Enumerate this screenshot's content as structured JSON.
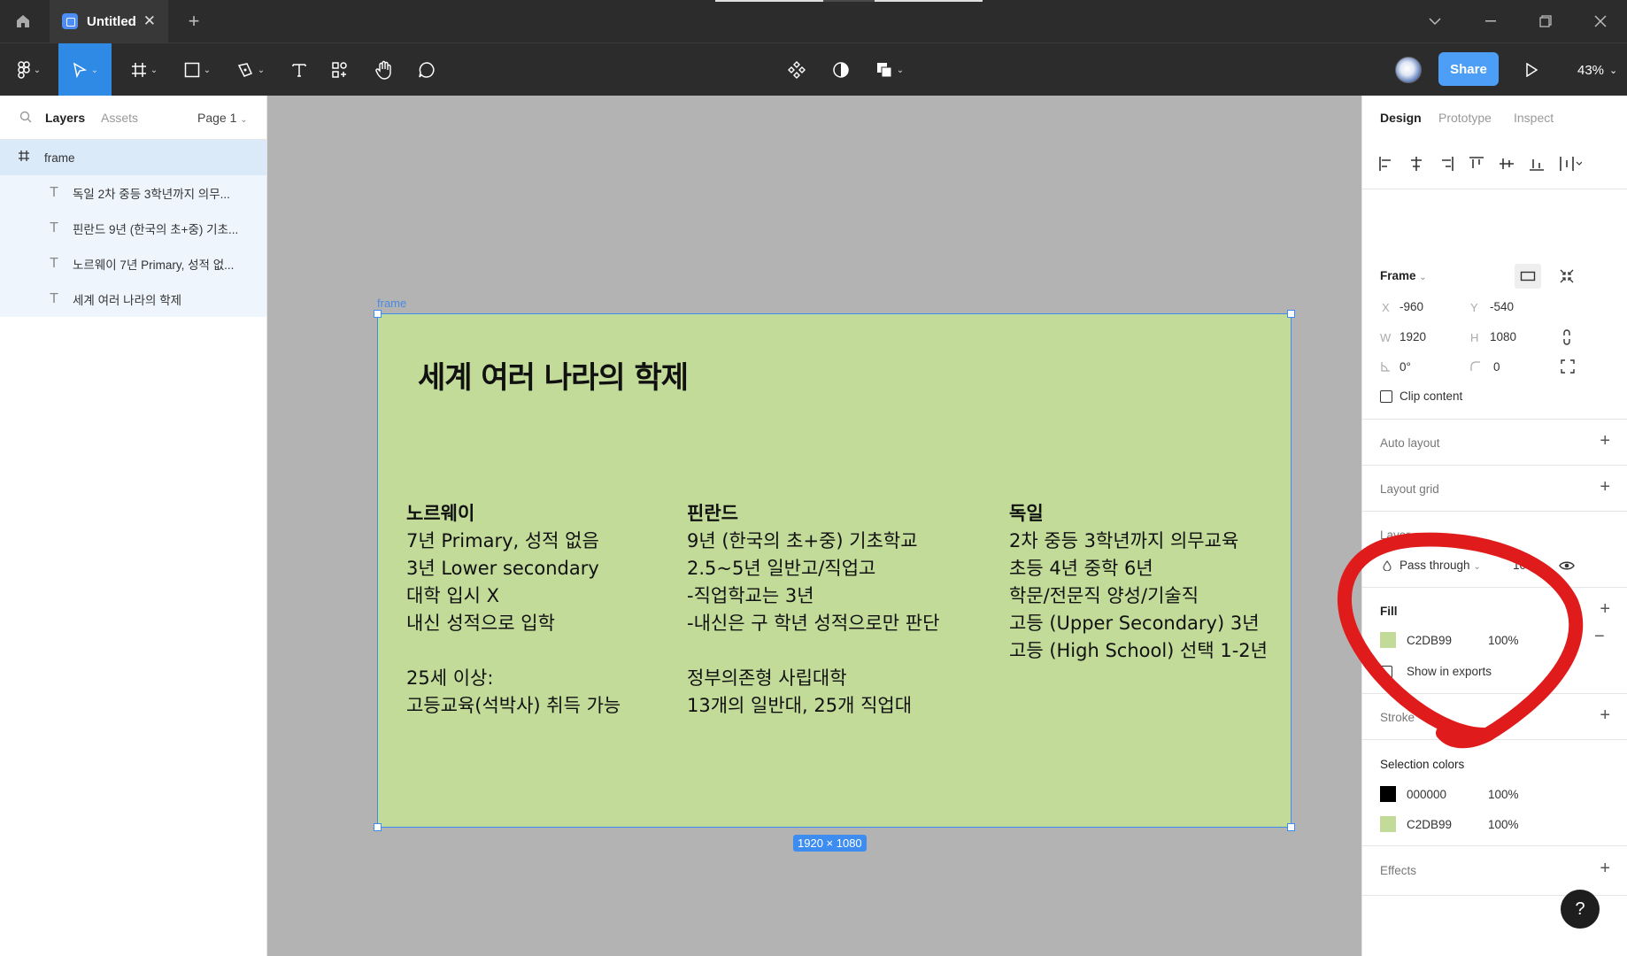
{
  "titlebar": {
    "tab_title": "Untitled",
    "close_glyph": "✕",
    "new_tab_glyph": "+"
  },
  "toolbar": {
    "share_label": "Share",
    "zoom_label": "43%"
  },
  "left_panel": {
    "tab_layers": "Layers",
    "tab_assets": "Assets",
    "page_label": "Page 1",
    "layers": [
      {
        "name": "frame",
        "icon": "frame-icon"
      },
      {
        "name": "독일 2차 중등 3학년까지 의무...",
        "icon": "text-icon"
      },
      {
        "name": "핀란드 9년 (한국의 초+중) 기초...",
        "icon": "text-icon"
      },
      {
        "name": "노르웨이 7년 Primary, 성적 없...",
        "icon": "text-icon"
      },
      {
        "name": "세계 여러 나라의 학제",
        "icon": "text-icon"
      }
    ]
  },
  "canvas": {
    "frame_label": "frame",
    "title": "세계 여러 나라의 학제",
    "dimensions_badge": "1920 × 1080",
    "columns": [
      {
        "heading": "노르웨이",
        "lines": [
          "7년 Primary, 성적 없음",
          "3년 Lower secondary",
          "대학 입시 X",
          "내신 성적으로 입학",
          "",
          "25세 이상:",
          "고등교육(석박사) 취득 가능"
        ]
      },
      {
        "heading": "핀란드",
        "lines": [
          "9년 (한국의 초+중) 기초학교",
          "2.5~5년 일반고/직업고",
          "-직업학교는 3년",
          "-내신은 구 학년 성적으로만 판단",
          "",
          "정부의존형 사립대학",
          "13개의 일반대, 25개 직업대"
        ]
      },
      {
        "heading": "독일",
        "lines": [
          "2차 중등 3학년까지 의무교육",
          "초등 4년 중학 6년",
          "학문/전문직 양성/기술직",
          "고등 (Upper Secondary) 3년",
          "고등 (High School) 선택 1-2년"
        ]
      }
    ]
  },
  "right_panel": {
    "tabs": [
      "Design",
      "Prototype",
      "Inspect"
    ],
    "frame_section": {
      "title": "Frame",
      "x_label": "X",
      "x": "-960",
      "y_label": "Y",
      "y": "-540",
      "w_label": "W",
      "w": "1920",
      "h_label": "H",
      "h": "1080",
      "rotation": "0°",
      "radius": "0",
      "clip_content": "Clip content"
    },
    "auto_layout": "Auto layout",
    "layout_grid": "Layout grid",
    "layer_section": {
      "title": "Layer",
      "blend_mode": "Pass through",
      "opacity": "100%"
    },
    "fill_section": {
      "title": "Fill",
      "hex": "C2DB99",
      "opacity": "100%",
      "show_in_exports": "Show in exports",
      "color": "#c2db99"
    },
    "stroke_section": {
      "title": "Stroke"
    },
    "selection_colors": {
      "title": "Selection colors",
      "items": [
        {
          "hex": "000000",
          "opacity": "100%",
          "color": "#000000"
        },
        {
          "hex": "C2DB99",
          "opacity": "100%",
          "color": "#c2db99"
        }
      ]
    },
    "effects": "Effects",
    "help_label": "?"
  },
  "colors": {
    "accent": "#3d8df0",
    "share": "#4d9ef7",
    "frame_fill": "#c2db99",
    "annotation": "#e01b1b"
  }
}
